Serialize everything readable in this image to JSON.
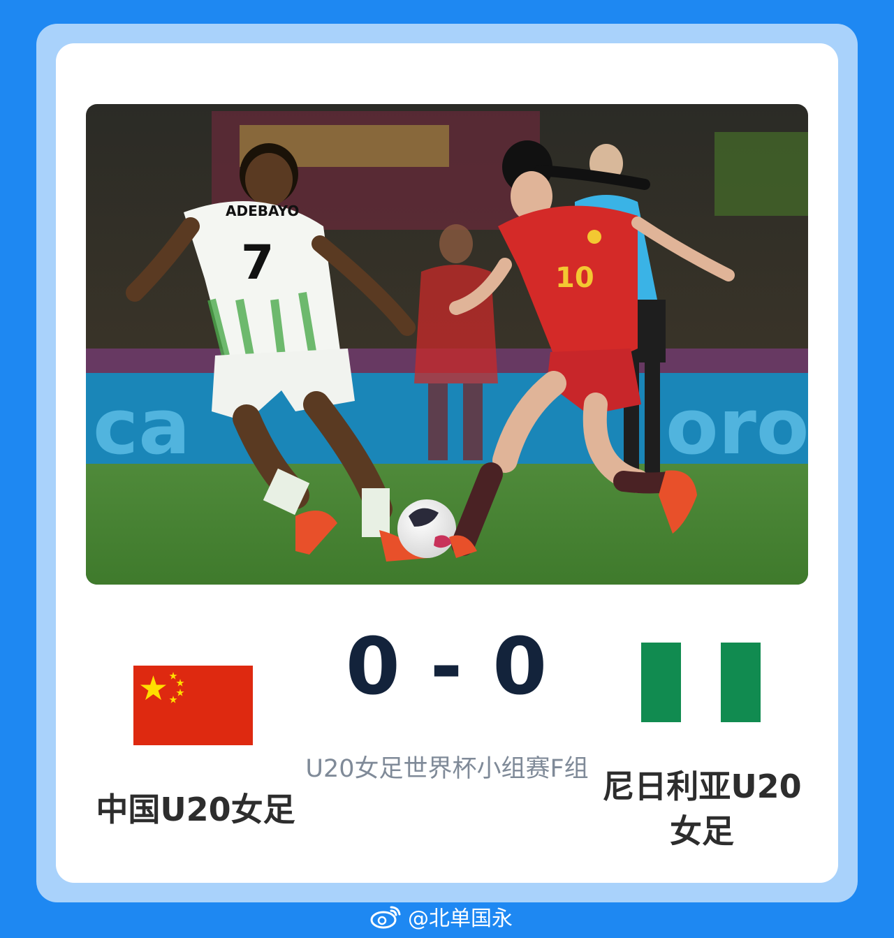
{
  "colors": {
    "background_blue": "#1e88f2",
    "frame_light_blue": "#a9d2fb",
    "card_white": "#ffffff",
    "score_navy": "#13233b",
    "china_red": "#de2910",
    "china_star_yellow": "#ffde00",
    "nigeria_green": "#118b50"
  },
  "photo": {
    "jersey_name": "ADEBAYO",
    "jersey_number_left": "7",
    "jersey_number_right": "10"
  },
  "match": {
    "score": "0 - 0",
    "subtitle": "U20女足世界杯小组赛F组"
  },
  "teams": {
    "home": {
      "name": "中国U20女足",
      "flag_icon": "china-flag-icon"
    },
    "away": {
      "name_line1": "尼日利亚U20",
      "name_line2": "女足",
      "flag_icon": "nigeria-flag-icon"
    }
  },
  "watermark": {
    "icon": "weibo-logo-icon",
    "handle": "@北单国永"
  }
}
